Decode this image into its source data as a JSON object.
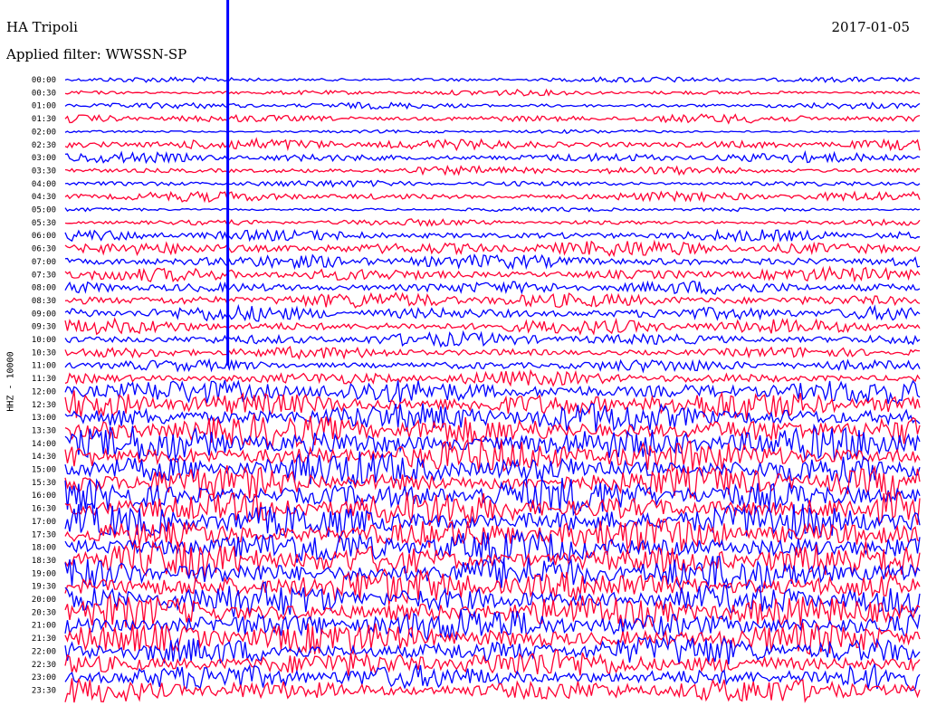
{
  "header": {
    "station": "HA Tripoli",
    "date": "2017-01-05",
    "filter": "Applied filter: WWSSN-SP"
  },
  "chart_data": {
    "type": "line",
    "title": "HA Tripoli",
    "subtitle": "Applied filter: WWSSN-SP",
    "ylabel": "HHZ - 10000",
    "date": "2017-01-05",
    "row_labels": [
      "00:00",
      "00:30",
      "01:00",
      "01:30",
      "02:00",
      "02:30",
      "03:00",
      "03:30",
      "04:00",
      "04:30",
      "05:00",
      "05:30",
      "06:00",
      "06:30",
      "07:00",
      "07:30",
      "08:00",
      "08:30",
      "09:00",
      "09:30",
      "10:00",
      "10:30",
      "11:00",
      "11:30",
      "12:00",
      "12:30",
      "13:00",
      "13:30",
      "14:00",
      "14:30",
      "15:00",
      "15:30",
      "16:00",
      "16:30",
      "17:00",
      "17:30",
      "18:00",
      "18:30",
      "19:00",
      "19:30",
      "20:00",
      "20:30",
      "21:00",
      "21:30",
      "22:00",
      "22:30",
      "23:00",
      "23:30"
    ],
    "trace_colors": [
      "#0000ff",
      "#ff0033"
    ],
    "relative_amplitude": [
      0.8,
      0.8,
      0.9,
      1.2,
      0.5,
      1.6,
      1.4,
      1.2,
      0.9,
      1.4,
      0.6,
      0.9,
      1.6,
      2.2,
      2.0,
      1.9,
      1.9,
      2.2,
      2.1,
      2.1,
      1.9,
      1.6,
      1.7,
      2.0,
      3.5,
      4.0,
      4.3,
      4.6,
      4.8,
      4.8,
      4.8,
      4.6,
      5.0,
      5.0,
      5.0,
      5.0,
      5.0,
      5.0,
      5.0,
      5.0,
      4.8,
      4.8,
      4.6,
      4.6,
      4.2,
      4.0,
      3.6,
      3.4
    ],
    "events": [
      {
        "row": "02:00",
        "x_fraction": 0.15,
        "magnitude": "large"
      }
    ],
    "colors": {
      "blue": "#0000ff",
      "red": "#ff0033",
      "background": "#ffffff"
    }
  }
}
